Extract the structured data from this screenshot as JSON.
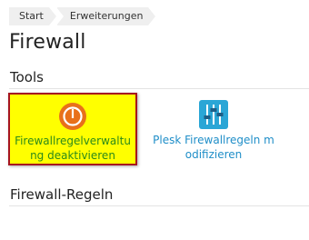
{
  "breadcrumb": {
    "items": [
      {
        "label": "Start"
      },
      {
        "label": "Erweiterungen"
      }
    ]
  },
  "page": {
    "title": "Firewall"
  },
  "sections": {
    "tools": {
      "title": "Tools",
      "items": [
        {
          "label": "Firewallregelverwaltung deaktivieren",
          "icon": "power-icon",
          "icon_color": "#e8701a",
          "highlight_color": "#ffff00",
          "highlight_border": "#a6151f"
        },
        {
          "label": "Plesk Firewallregeln modifizieren",
          "icon": "sliders-icon",
          "icon_color": "#2aa6d6"
        }
      ]
    },
    "rules": {
      "title": "Firewall-Regeln"
    }
  }
}
